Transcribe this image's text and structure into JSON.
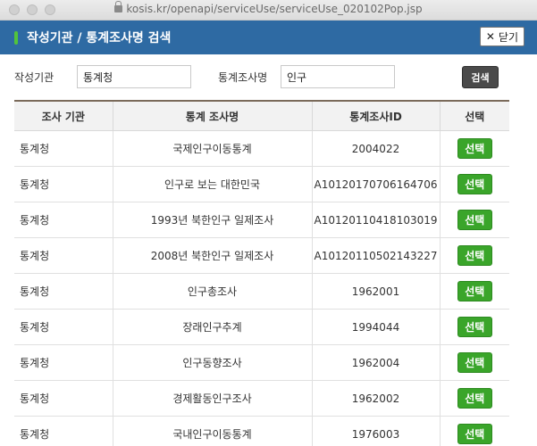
{
  "browser": {
    "url": "kosis.kr/openapi/serviceUse/serviceUse_020102Pop.jsp"
  },
  "header": {
    "title": "작성기관 / 통계조사명 검색",
    "close_label": "닫기"
  },
  "search": {
    "agency_label": "작성기관",
    "agency_value": "통계청",
    "survey_label": "통계조사명",
    "survey_value": "인구",
    "button_label": "검색"
  },
  "table": {
    "columns": [
      "조사 기관",
      "통계 조사명",
      "통계조사ID",
      "선택"
    ],
    "rows": [
      {
        "agency": "통계청",
        "name": "국제인구이동통계",
        "id": "2004022",
        "action": "선택"
      },
      {
        "agency": "통계청",
        "name": "인구로 보는 대한민국",
        "id": "A10120170706164706",
        "action": "선택"
      },
      {
        "agency": "통계청",
        "name": "1993년 북한인구 일제조사",
        "id": "A10120110418103019",
        "action": "선택"
      },
      {
        "agency": "통계청",
        "name": "2008년 북한인구 일제조사",
        "id": "A10120110502143227",
        "action": "선택"
      },
      {
        "agency": "통계청",
        "name": "인구총조사",
        "id": "1962001",
        "action": "선택"
      },
      {
        "agency": "통계청",
        "name": "장래인구추계",
        "id": "1994044",
        "action": "선택"
      },
      {
        "agency": "통계청",
        "name": "인구동향조사",
        "id": "1962004",
        "action": "선택"
      },
      {
        "agency": "통계청",
        "name": "경제활동인구조사",
        "id": "1962002",
        "action": "선택"
      },
      {
        "agency": "통계청",
        "name": "국내인구이동통계",
        "id": "1976003",
        "action": "선택"
      }
    ]
  },
  "colors": {
    "header_bg": "#2e6aa3",
    "select_button": "#3aa52a",
    "search_button": "#4a4a4a"
  }
}
